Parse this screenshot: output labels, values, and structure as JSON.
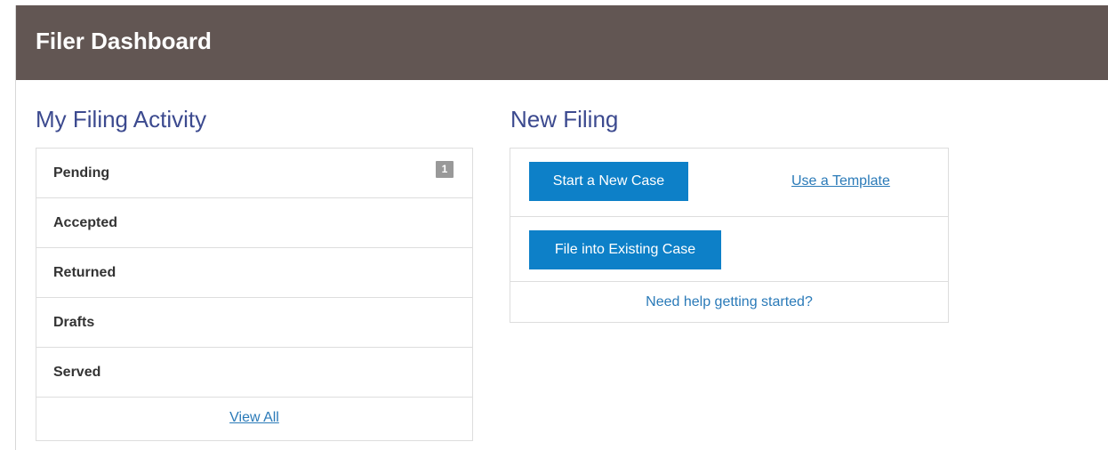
{
  "header": {
    "title": "Filer Dashboard",
    "background_color": "#625653"
  },
  "activity": {
    "title": "My Filing Activity",
    "items": [
      {
        "label": "Pending",
        "count": "1"
      },
      {
        "label": "Accepted"
      },
      {
        "label": "Returned"
      },
      {
        "label": "Drafts"
      },
      {
        "label": "Served"
      }
    ],
    "view_all_label": "View All"
  },
  "new_filing": {
    "title": "New Filing",
    "start_case_label": "Start a New Case",
    "template_label": "Use a Template",
    "existing_case_label": "File into Existing Case",
    "help_label": "Need help getting started?"
  },
  "colors": {
    "accent_blue": "#0d80c8",
    "title_blue": "#3c4a8f",
    "link_blue": "#2a7ab8",
    "badge_gray": "#999999"
  }
}
